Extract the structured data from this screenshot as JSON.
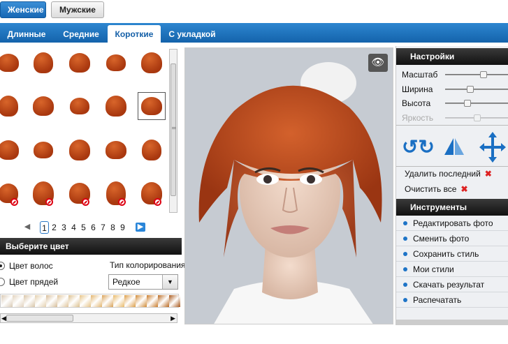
{
  "gender_tabs": [
    {
      "label": "Женские",
      "active": true
    },
    {
      "label": "Мужские",
      "active": false
    }
  ],
  "length_tabs": [
    {
      "label": "Длинные",
      "active": false
    },
    {
      "label": "Средние",
      "active": false
    },
    {
      "label": "Короткие",
      "active": true
    },
    {
      "label": "С укладкой",
      "active": false
    }
  ],
  "hairstyle_grid": {
    "rows": 4,
    "cols": 5,
    "selected_index": 9,
    "unavailable_indices": [
      15,
      16,
      17,
      18,
      19
    ]
  },
  "pagination": {
    "pages": [
      "1",
      "2",
      "3",
      "4",
      "5",
      "6",
      "7",
      "8",
      "9"
    ],
    "current": "1",
    "prev_icon": "arrow-left-icon",
    "next_icon": "arrow-right-icon"
  },
  "color_panel": {
    "title": "Выберите цвет",
    "options": [
      {
        "label": "Цвет волос",
        "checked": true
      },
      {
        "label": "Цвет прядей",
        "checked": false
      }
    ],
    "coloring_type_label": "Тип колорирования",
    "coloring_type_value": "Редкое",
    "swatches": [
      "#d9c9b3",
      "#e2d2bd",
      "#d8c4a6",
      "#e4d0ae",
      "#d7bd98",
      "#e0c49a",
      "#dcc08e",
      "#e6c386",
      "#e2b46c",
      "#d9a258",
      "#e8b968",
      "#dc9d47",
      "#d08a36",
      "#c97b2a",
      "#b9681f",
      "#a9581a"
    ]
  },
  "photo": {
    "view_icon": "eye-icon"
  },
  "settings": {
    "title": "Настройки",
    "sliders": [
      {
        "label": "Масштаб",
        "value": 0.6,
        "enabled": true
      },
      {
        "label": "Ширина",
        "value": 0.4,
        "enabled": true
      },
      {
        "label": "Высота",
        "value": 0.35,
        "enabled": true
      },
      {
        "label": "Яркость",
        "value": 0.5,
        "enabled": false
      }
    ],
    "icons": [
      "rotate-icon",
      "flip-icon",
      "move-icon"
    ],
    "delete_last": "Удалить последний",
    "clear_all": "Очистить все"
  },
  "tools": {
    "title": "Инструменты",
    "items": [
      "Редактировать фото",
      "Сменить фото",
      "Сохранить стиль",
      "Мои стили",
      "Скачать результат",
      "Распечатать"
    ]
  }
}
